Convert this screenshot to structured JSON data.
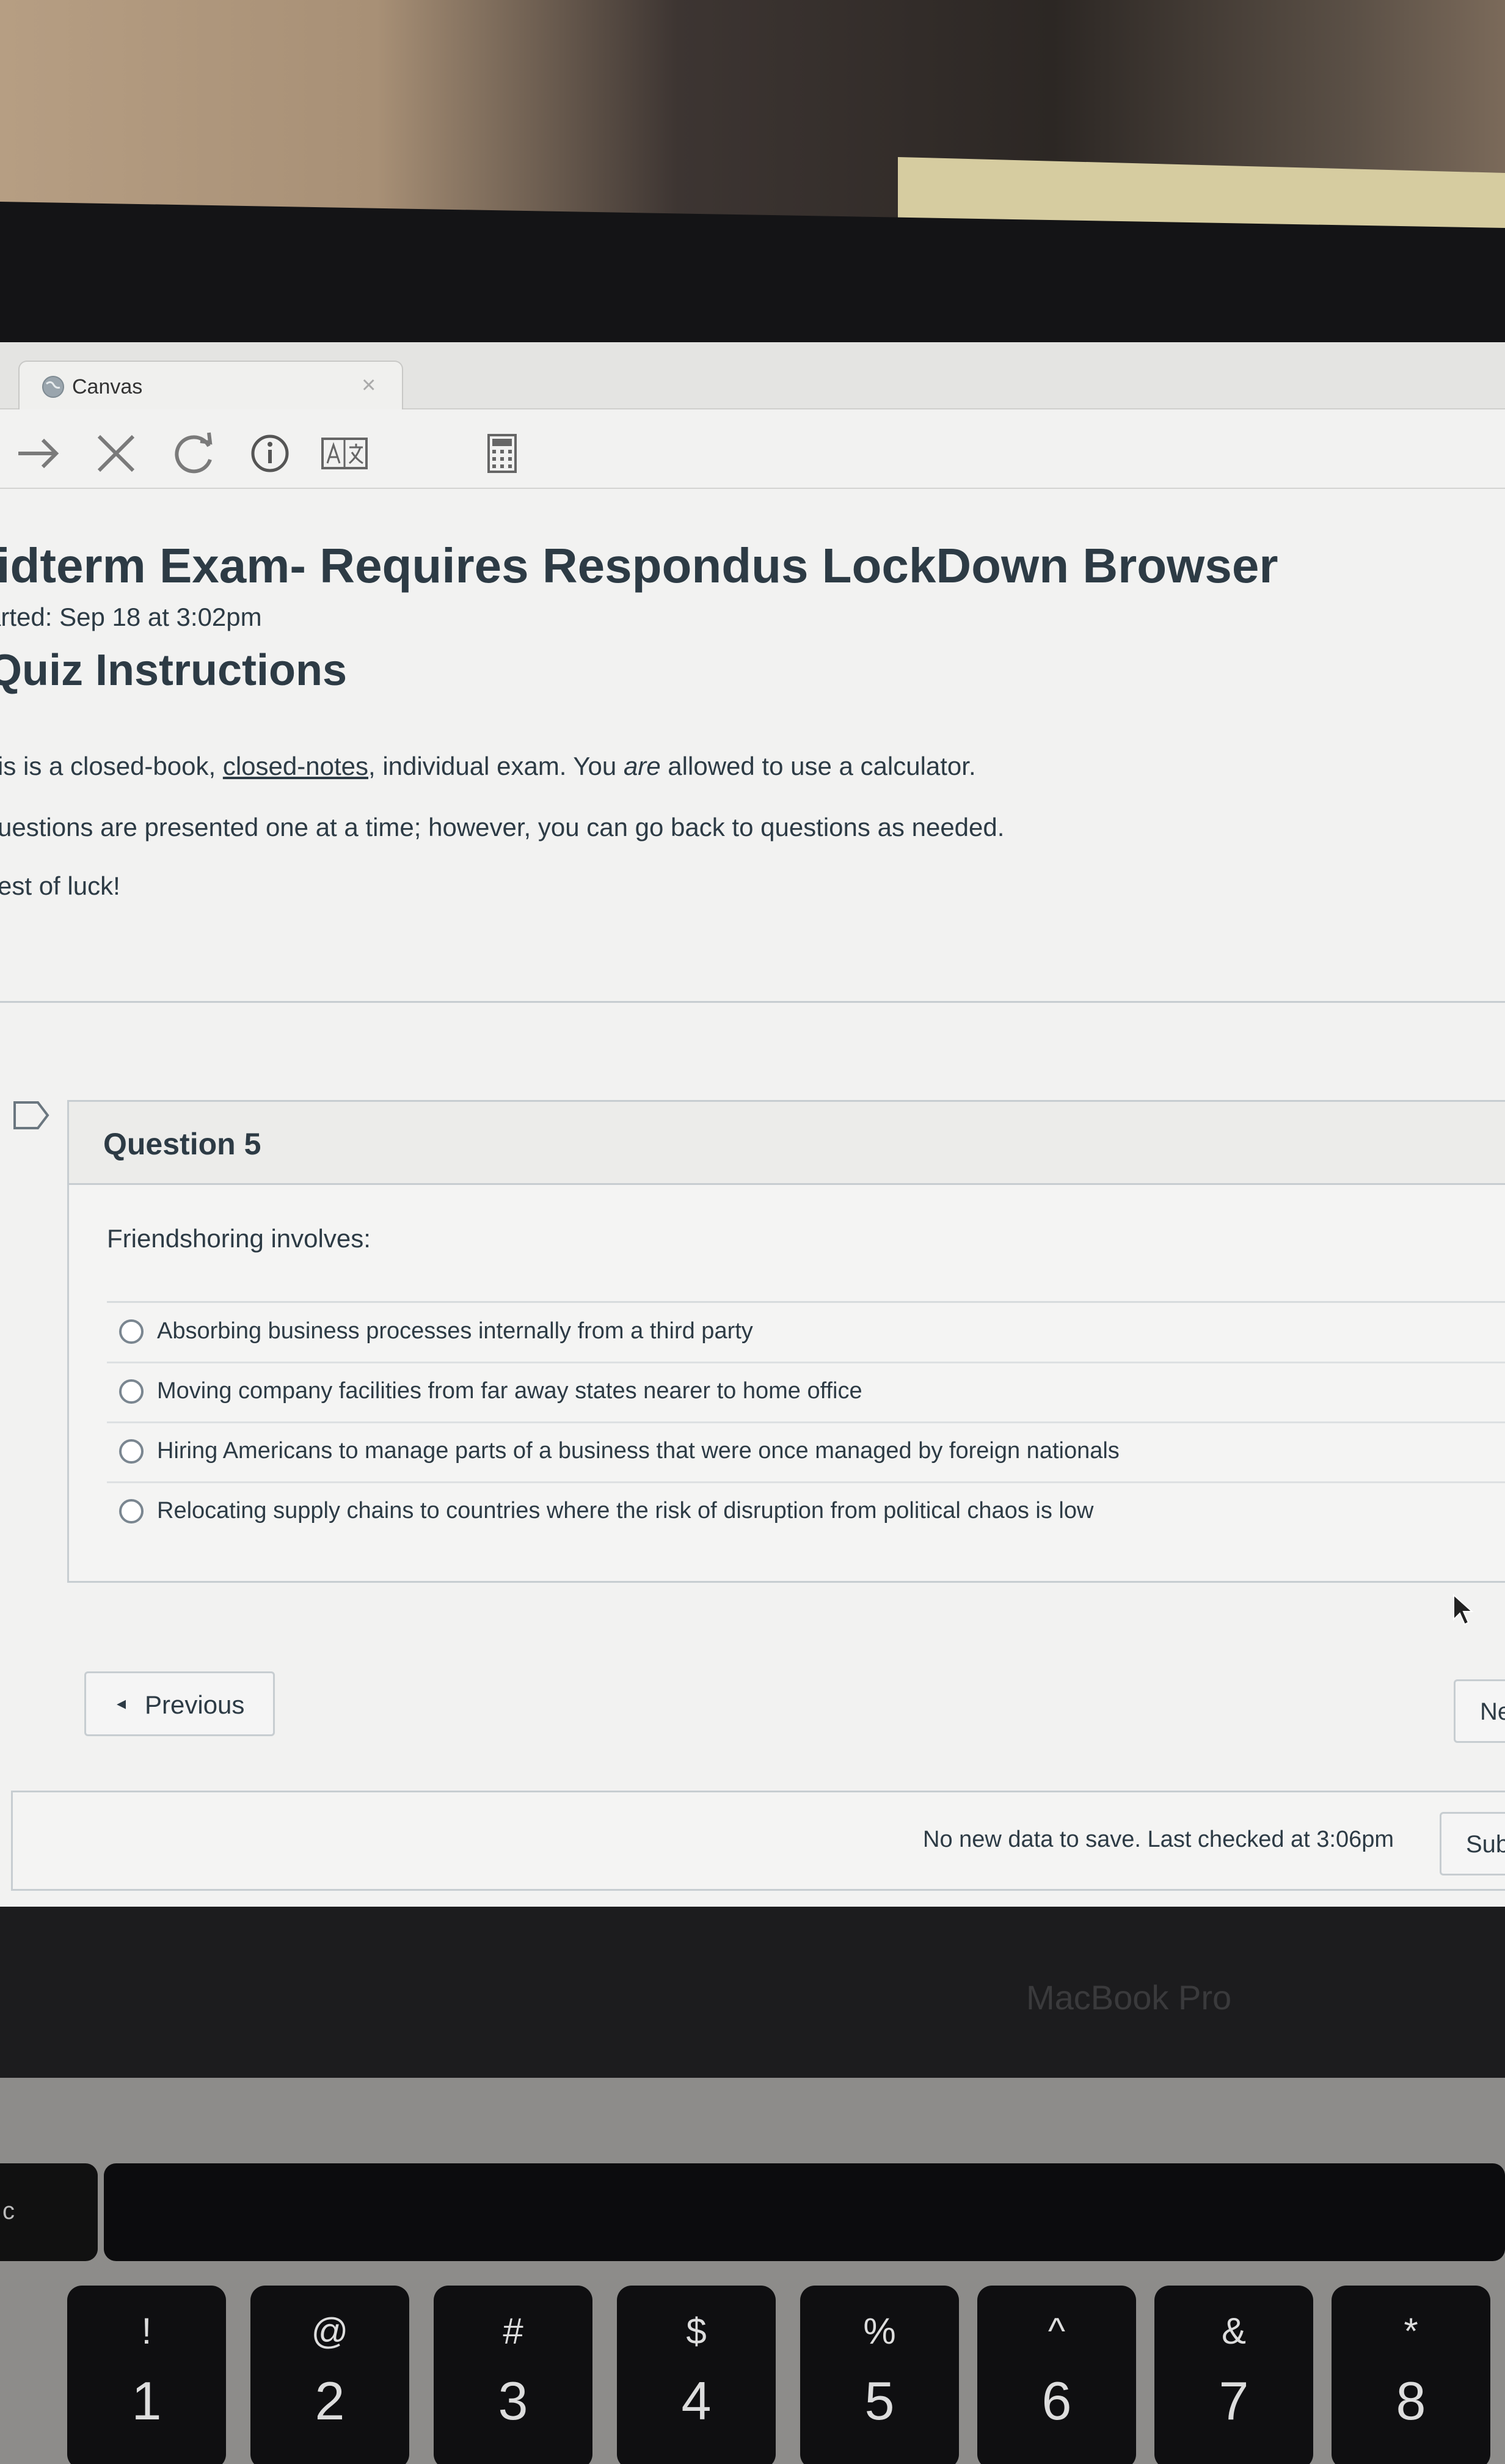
{
  "browser": {
    "tab_title": "Canvas",
    "tab_close": "×",
    "toolbar": [
      "forward-icon",
      "stop-icon",
      "reload-icon",
      "info-icon",
      "translate-icon",
      "calculator-icon"
    ]
  },
  "quiz": {
    "title": "lidterm Exam- Requires Respondus LockDown Browser",
    "started": "arted: Sep 18 at 3:02pm",
    "instructions_heading": "Quiz Instructions",
    "instructions": {
      "line1_a": "is is a closed-book, ",
      "line1_link": "closed-notes",
      "line1_b": ", individual exam. You ",
      "line1_em": "are",
      "line1_c": " allowed to use a calculator.",
      "line2": "uestions are presented one at a time; however, you can go back to questions as needed.",
      "line3": "est of luck!"
    }
  },
  "question": {
    "title": "Question 5",
    "text": "Friendshoring involves:",
    "answers": [
      "Absorbing business processes internally from a third party",
      "Moving company facilities from far away states nearer to home office",
      "Hiring Americans to manage parts of a business that were once managed by foreign nationals",
      "Relocating supply chains to countries where the risk of disruption from political chaos is low"
    ]
  },
  "nav": {
    "previous_arrow": "◂",
    "previous_label": "Previous",
    "next_label": "Ne"
  },
  "footer": {
    "save_status": "No new data to save. Last checked at 3:06pm",
    "submit_label": "Sub"
  },
  "device": {
    "brand_label": "MacBook Pro",
    "esc_label": "c",
    "keys": [
      {
        "sym": "!",
        "num": "1"
      },
      {
        "sym": "@",
        "num": "2"
      },
      {
        "sym": "#",
        "num": "3"
      },
      {
        "sym": "$",
        "num": "4"
      },
      {
        "sym": "%",
        "num": "5"
      },
      {
        "sym": "^",
        "num": "6"
      },
      {
        "sym": "&",
        "num": "7"
      },
      {
        "sym": "*",
        "num": "8"
      }
    ]
  },
  "colors": {
    "text": "#2d3b45",
    "border": "#c7cdd1",
    "screen_bg": "#f2f2f1"
  }
}
